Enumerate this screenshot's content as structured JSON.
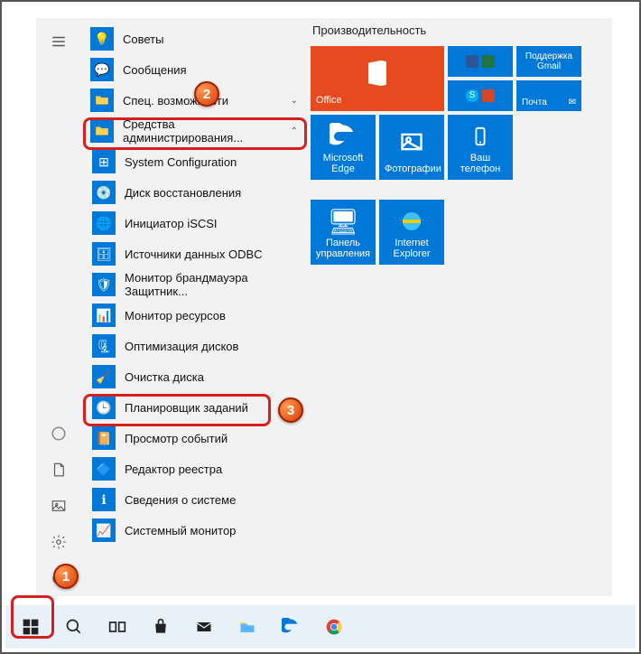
{
  "tiles_header": "Производительность",
  "apps": {
    "tips": "Советы",
    "messages": "Сообщения",
    "ease": "Спец. возможности",
    "admin": "Средства администрирования...",
    "sysconfig": "System Configuration",
    "recovery": "Диск восстановления",
    "iscsi": "Инициатор iSCSI",
    "odbc": "Источники данных ODBC",
    "firewall": "Монитор брандмауэра Защитник...",
    "resmon": "Монитор ресурсов",
    "diskopt": "Оптимизация дисков",
    "diskclean": "Очистка диска",
    "tasksched": "Планировщик заданий",
    "eventvwr": "Просмотр событий",
    "regedit": "Редактор реестра",
    "sysinfo": "Сведения о системе",
    "sysmon": "Системный монитор"
  },
  "tiles": {
    "office": "Office",
    "gmail": "Поддержка Gmail",
    "mail": "Почта",
    "edge": "Microsoft Edge",
    "photos": "Фотографии",
    "phone": "Ваш телефон",
    "cpanel": "Панель управления",
    "ie": "Internet Explorer"
  },
  "badges": {
    "b1": "1",
    "b2": "2",
    "b3": "3"
  }
}
